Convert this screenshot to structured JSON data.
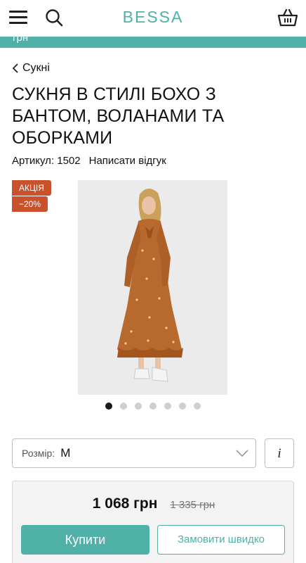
{
  "header": {
    "logo": "BESSA",
    "promo_text": "грн"
  },
  "breadcrumb": {
    "label": "Сукні"
  },
  "product": {
    "title": "СУКНЯ В СТИЛІ БОХО З БАНТОМ, ВОЛАНАМИ ТА ОБОРКАМИ",
    "sku": "Артикул: 1502",
    "review_link": "Написати відгук",
    "badges": {
      "sale": "АКЦІЯ",
      "discount": "−20%"
    }
  },
  "gallery": {
    "total_images": 7,
    "active_index": 0
  },
  "size_selector": {
    "label": "Розмір:",
    "value": "M",
    "info_label": "i"
  },
  "purchase": {
    "price": "1 068 грн",
    "old_price": "1 335 грн",
    "buy_label": "Купити",
    "quick_order_label": "Замовити швидко"
  },
  "colors": {
    "accent": "#4fb1a7",
    "badge": "#c9512c"
  }
}
